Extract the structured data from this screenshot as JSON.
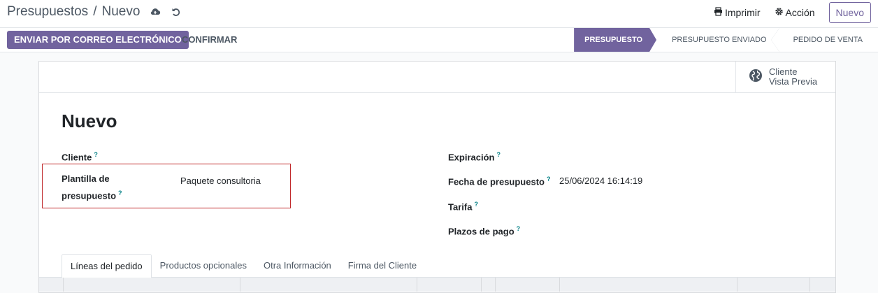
{
  "breadcrumb": {
    "parent": "Presupuestos",
    "separator": "/",
    "current": "Nuevo"
  },
  "top_actions": {
    "print_label": "Imprimir",
    "action_label": "Acción",
    "new_label": "Nuevo"
  },
  "statusbar": {
    "send_email_label": "ENVIAR POR CORREO ELECTRÓNICO",
    "confirm_label": "CONFIRMAR",
    "stages": [
      "PRESUPUESTO",
      "PRESUPUESTO ENVIADO",
      "PEDIDO DE VENTA"
    ],
    "active_stage": "PRESUPUESTO"
  },
  "smart_button": {
    "line1": "Cliente",
    "line2": "Vista Previa"
  },
  "form": {
    "title": "Nuevo",
    "left": {
      "cliente_label": "Cliente",
      "plantilla_label_line1": "Plantilla de",
      "plantilla_label_line2": "presupuesto",
      "plantilla_value": "Paquete consultoria"
    },
    "right": {
      "expiracion_label": "Expiración",
      "fecha_label": "Fecha de presupuesto",
      "fecha_value": "25/06/2024 16:14:19",
      "tarifa_label": "Tarifa",
      "plazos_label": "Plazos de pago"
    },
    "help_marker": "?"
  },
  "tabs": [
    "Líneas del pedido",
    "Productos opcionales",
    "Otra Información",
    "Firma del Cliente"
  ],
  "colors": {
    "primary": "#71639e",
    "highlight_border": "#c0282a",
    "help": "#017e84"
  }
}
